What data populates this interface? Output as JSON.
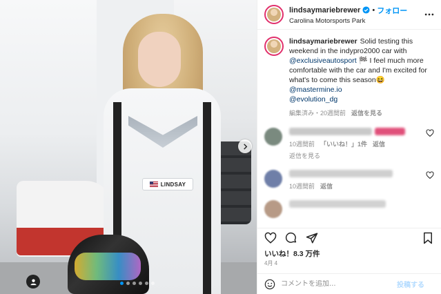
{
  "header": {
    "username": "lindsaymariebrewer",
    "separator": "•",
    "follow_label": "フォロー",
    "location": "Carolina Motorsports Park"
  },
  "photo": {
    "suit_name": "LINDSAY",
    "carousel_dots": 6,
    "active_dot": 0
  },
  "caption": {
    "username": "lindsaymariebrewer",
    "text_part1": "Solid testing this weekend in the indypro2000 car with ",
    "mention1": "@exclusiveautosport",
    "text_part2": " 🏁 I feel much more comfortable with the car and I'm excited for what's to come this season😆 ",
    "mention2": "@mastermine.io",
    "mention3": "@evolution_dg",
    "meta_time": "編集済み・20週間前",
    "meta_reply": "返信を見る"
  },
  "comments": [
    {
      "meta_time": "10週間前",
      "meta_likes": "「いいね！」1件",
      "meta_reply": "返信",
      "view_replies": "返信を見る",
      "avatar_color": "#7a8a7f",
      "text_color": "#c9c9c9",
      "emoji_color": "#e0507a"
    },
    {
      "meta_time": "10週間前",
      "meta_reply": "返信",
      "avatar_color": "#6f7fa8",
      "text_color": "#cfcfcf"
    },
    {
      "avatar_color": "#b79a86",
      "text_color": "#d2d2d2"
    }
  ],
  "likes": "いいね！8.3 万件",
  "date": "4月 4",
  "add_comment": {
    "placeholder": "コメントを追加...",
    "post_label": "投稿する"
  },
  "colors": {
    "accent": "#0095f6",
    "text": "#262626",
    "muted": "#8e8e8e",
    "border": "#efefef"
  }
}
